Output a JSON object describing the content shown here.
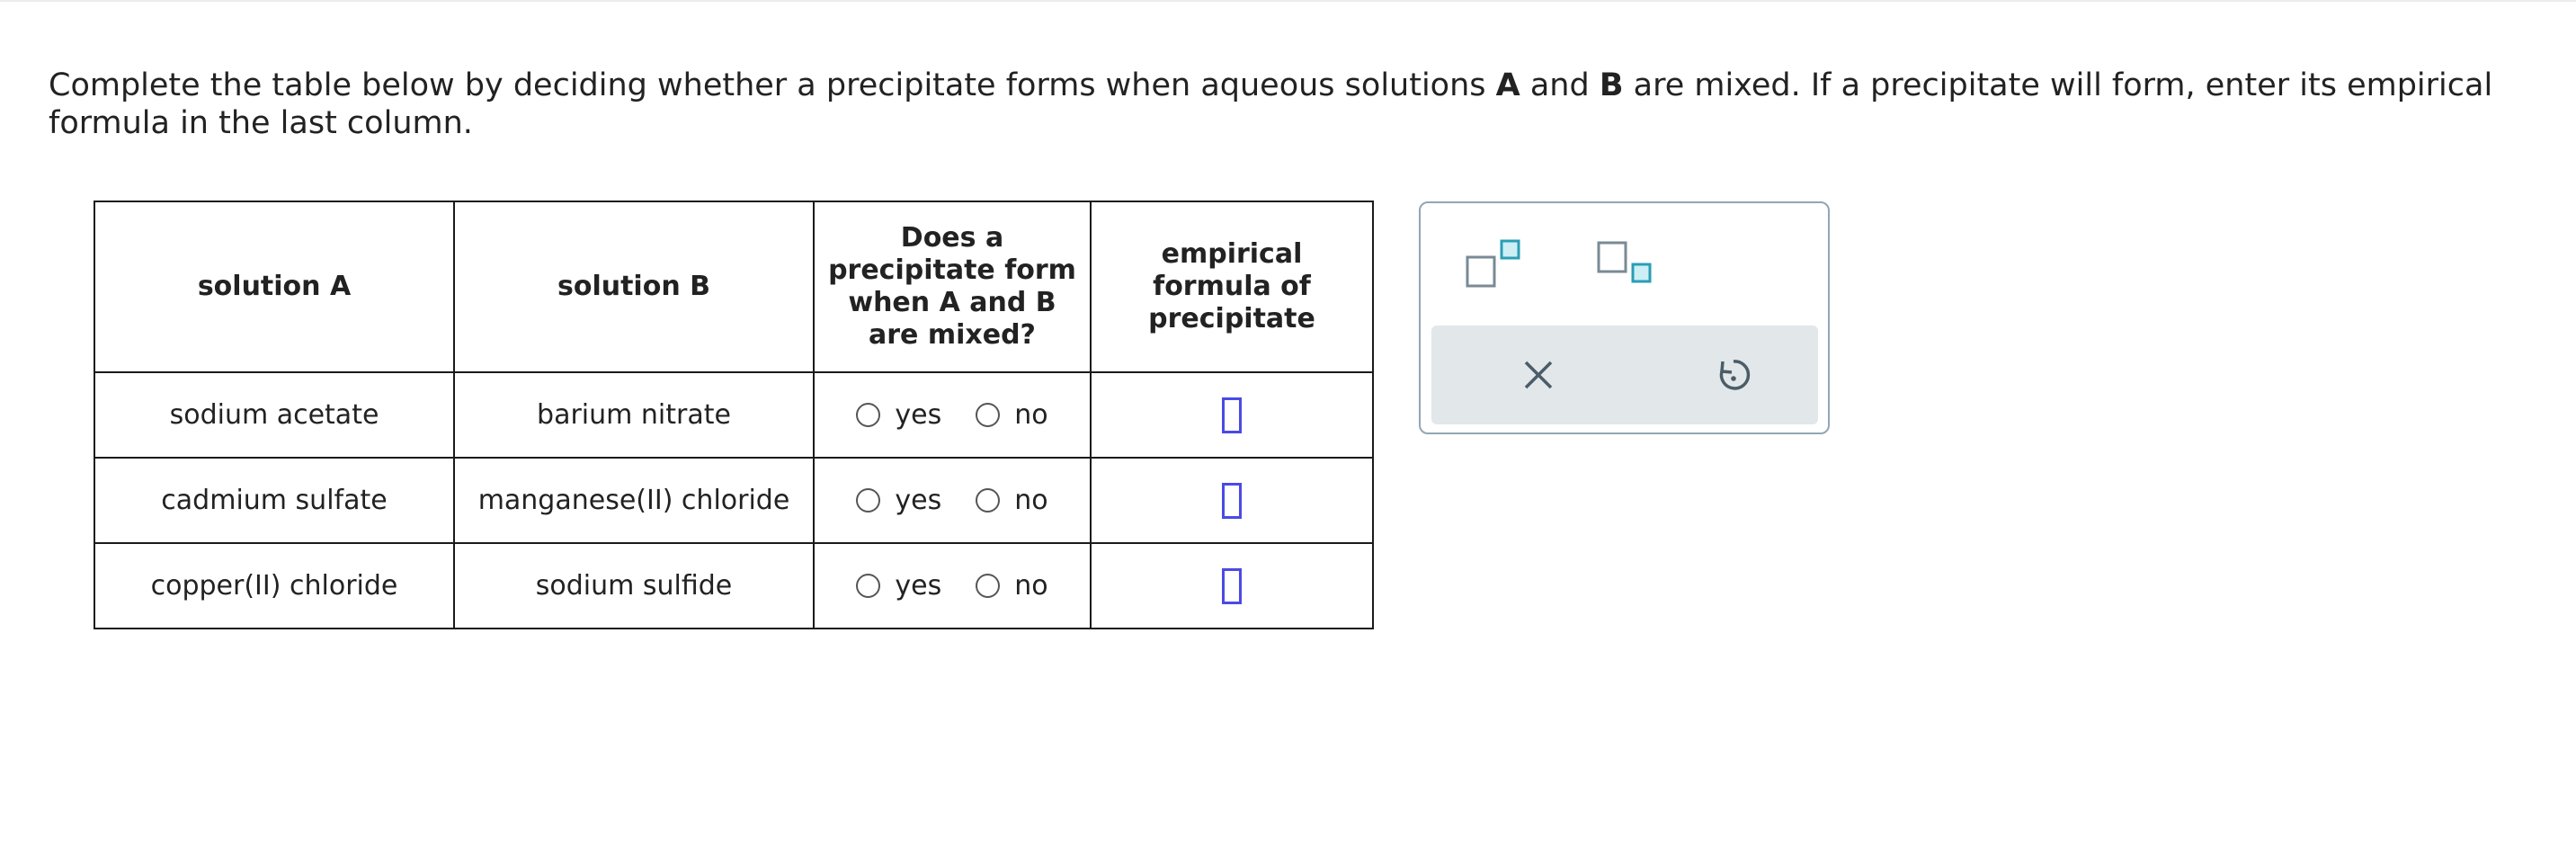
{
  "prompt": {
    "text1": "Complete the table below by deciding whether a precipitate forms when aqueous solutions ",
    "bold_a": "A",
    "text2": " and ",
    "bold_b": "B",
    "text3": " are mixed. If a precipitate will form, enter its empirical formula in the last column."
  },
  "table": {
    "headers": {
      "solution_a": "solution A",
      "solution_b": "solution B",
      "precipitate_question": "Does a precipitate form when A and B are mixed?",
      "empirical_formula": "empirical formula of precipitate"
    },
    "rows": [
      {
        "solution_a": "sodium acetate",
        "solution_b": "barium nitrate",
        "yes_label": "yes",
        "no_label": "no",
        "formula_value": ""
      },
      {
        "solution_a": "cadmium sulfate",
        "solution_b": "manganese(II) chloride",
        "yes_label": "yes",
        "no_label": "no",
        "formula_value": ""
      },
      {
        "solution_a": "copper(II) chloride",
        "solution_b": "sodium sulfide",
        "yes_label": "yes",
        "no_label": "no",
        "formula_value": ""
      }
    ]
  },
  "palette": {
    "tools": [
      "superscript-icon",
      "subscript-icon"
    ],
    "actions": [
      "close-icon",
      "undo-icon"
    ],
    "accent_color": "#2a9db5",
    "box_color": "#7a8a94",
    "input_border_color": "#4a4ae6"
  }
}
